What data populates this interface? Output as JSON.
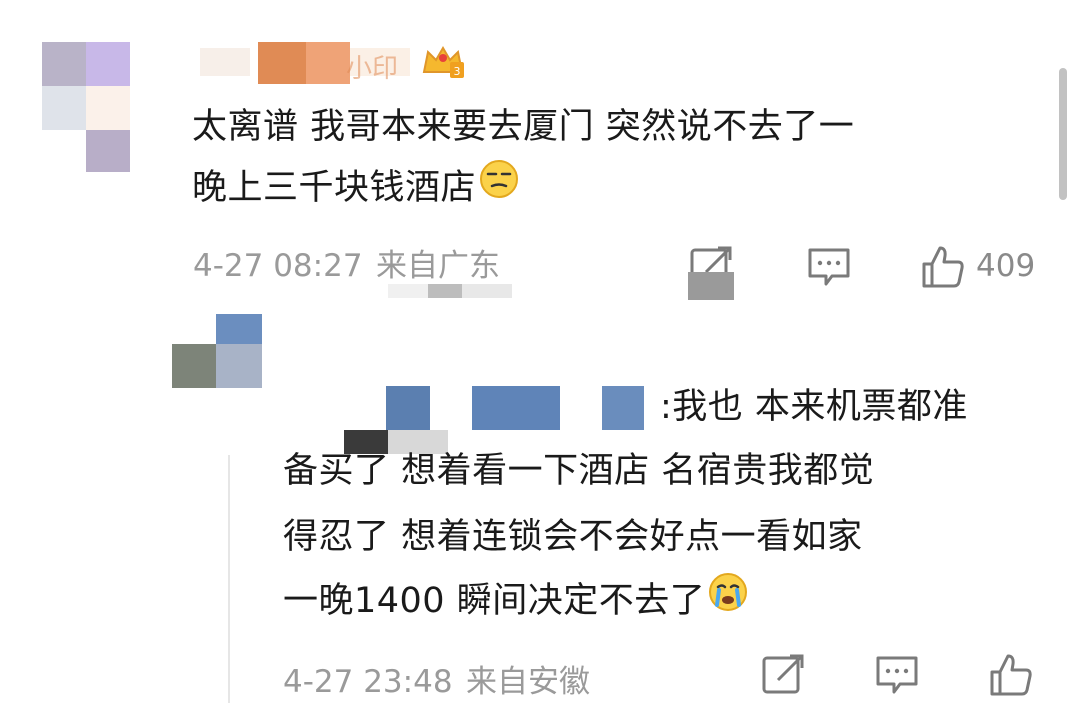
{
  "comment": {
    "text_line1": "太离谱 我哥本来要去厦门 突然说不去了一",
    "text_line2": "晚上三千块钱酒店",
    "emoji": "smirk-emoji",
    "time": "4-27 08:27",
    "location": "来自广东",
    "like_count": "409",
    "username_visible_fragment": "小印",
    "badge": "crown-badge"
  },
  "reply": {
    "text_line1": ":我也 本来机票都准",
    "text_line2": "备买了 想着看一下酒店 名宿贵我都觉",
    "text_line3": "得忍了 想着连锁会不会好点一看如家",
    "text_line4": "一晚1400 瞬间决定不去了",
    "emoji": "crying-emoji",
    "time": "4-27 23:48",
    "location": "来自安徽"
  },
  "icons": {
    "share": "share-icon",
    "comment": "comment-icon",
    "like": "thumbs-up-icon"
  },
  "colors": {
    "meta_text": "#9a9a9a",
    "body_text": "#1a1a1a",
    "scrollbar": "#c2c2c2"
  }
}
